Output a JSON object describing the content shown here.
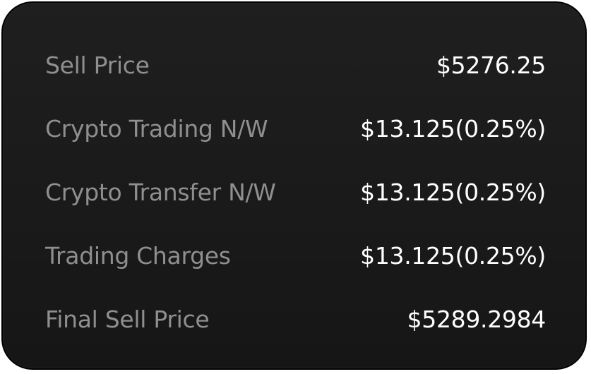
{
  "summary": {
    "rows": [
      {
        "label": "Sell Price",
        "value": "$5276.25"
      },
      {
        "label": "Crypto Trading N/W",
        "value": "$13.125(0.25%)"
      },
      {
        "label": "Crypto Transfer N/W",
        "value": "$13.125(0.25%)"
      },
      {
        "label": "Trading Charges",
        "value": "$13.125(0.25%)"
      },
      {
        "label": "Final Sell Price",
        "value": "$5289.2984"
      }
    ]
  },
  "colors": {
    "card_background": "#1a1a1a",
    "label": "#8f8f8f",
    "value": "#ffffff"
  }
}
